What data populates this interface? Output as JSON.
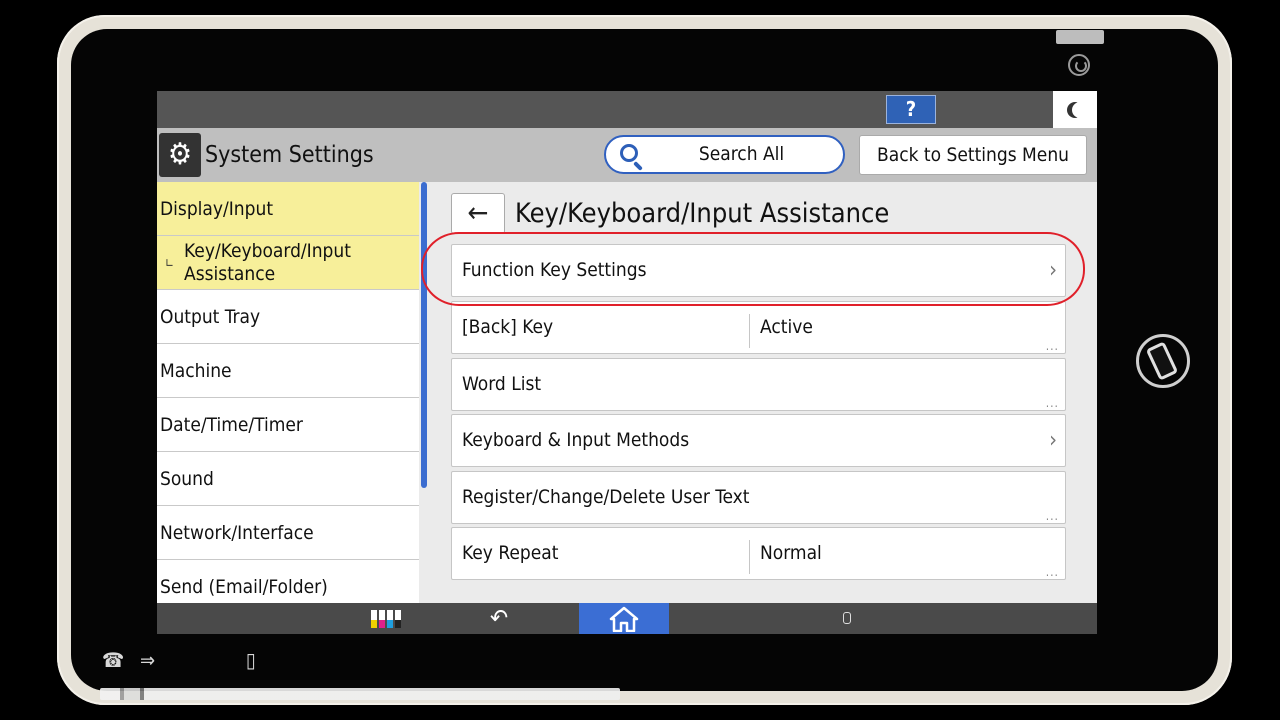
{
  "device": {
    "hardware_icons": [
      "power-icon",
      "nfc-phone-icon",
      "fax-icon",
      "login-icon",
      "document-icon"
    ]
  },
  "status_bar": {
    "help_label": "?",
    "sleep_icon": "moon-icon"
  },
  "header": {
    "app_icon": "gears-icon",
    "app_title": "System Settings",
    "search_label": "Search All",
    "back_to_menu_label": "Back to Settings Menu"
  },
  "sidebar": {
    "items": [
      {
        "label": "Display/Input",
        "selected": true
      },
      {
        "label": "Key/Keyboard/Input Assistance",
        "selected": true,
        "sub": true
      },
      {
        "label": "Output Tray"
      },
      {
        "label": "Machine"
      },
      {
        "label": "Date/Time/Timer"
      },
      {
        "label": "Sound"
      },
      {
        "label": "Network/Interface"
      },
      {
        "label": "Send (Email/Folder)"
      }
    ],
    "sub_line1": "Key/Keyboard/Input",
    "sub_line2": "Assistance"
  },
  "main": {
    "back_icon": "←",
    "title": "Key/Keyboard/Input Assistance",
    "rows": [
      {
        "label": "Function Key Settings",
        "value": "",
        "chevron": "›",
        "highlighted": true
      },
      {
        "label": "[Back] Key",
        "value": "Active",
        "dots": "..."
      },
      {
        "label": "Word List",
        "value": "",
        "dots": "..."
      },
      {
        "label": "Keyboard & Input Methods",
        "value": "",
        "chevron": "›"
      },
      {
        "label": "Register/Change/Delete User Text",
        "value": "",
        "dots": "..."
      },
      {
        "label": "Key Repeat",
        "value": "Normal",
        "dots": "..."
      }
    ]
  },
  "bottom_bar": {
    "toner_colors": [
      "#f0d000",
      "#e0208a",
      "#20a0e0",
      "#222222"
    ],
    "back_icon": "↶",
    "accent": "#3b6ed4"
  }
}
